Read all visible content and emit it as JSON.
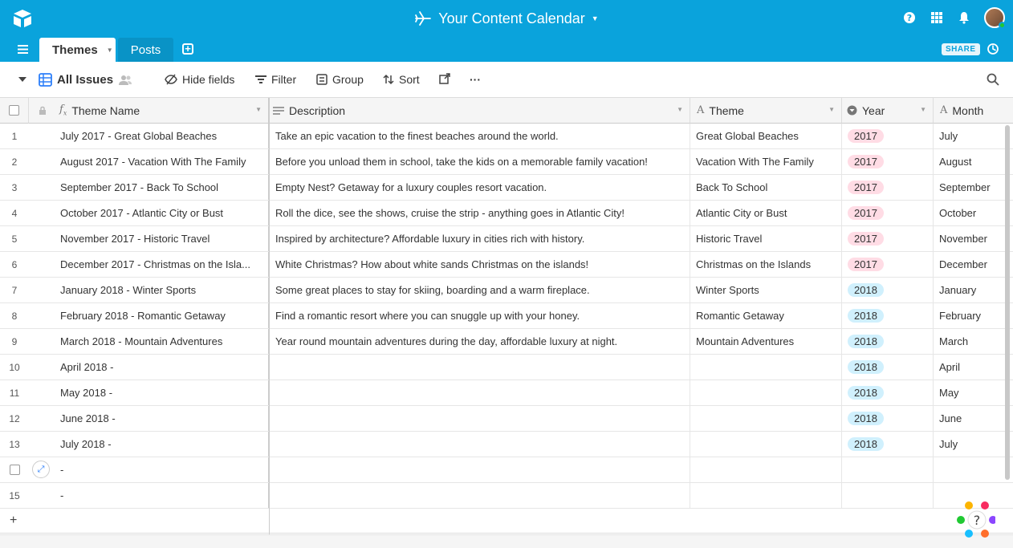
{
  "app": {
    "title": "Your Content Calendar",
    "brand_color": "#0aa3dc"
  },
  "tabs": [
    {
      "label": "Themes",
      "active": true
    },
    {
      "label": "Posts",
      "active": false
    }
  ],
  "share_label": "SHARE",
  "toolbar": {
    "view_name": "All Issues",
    "hide_fields": "Hide fields",
    "filter": "Filter",
    "group": "Group",
    "sort": "Sort",
    "more": "···"
  },
  "columns": {
    "name": "Theme Name",
    "description": "Description",
    "theme": "Theme",
    "year": "Year",
    "month": "Month"
  },
  "rows": [
    {
      "num": "1",
      "name": "July 2017 - Great Global Beaches",
      "description": "Take an epic vacation to the finest beaches around the world.",
      "theme": "Great Global Beaches",
      "year": "2017",
      "month": "July"
    },
    {
      "num": "2",
      "name": "August 2017 - Vacation With The Family",
      "description": "Before you unload them in school, take the kids on a memorable family vacation!",
      "theme": "Vacation With The Family",
      "year": "2017",
      "month": "August"
    },
    {
      "num": "3",
      "name": "September 2017 - Back To School",
      "description": "Empty Nest?  Getaway for a luxury couples resort vacation.",
      "theme": "Back To School",
      "year": "2017",
      "month": "September"
    },
    {
      "num": "4",
      "name": "October 2017 - Atlantic City or Bust",
      "description": "Roll the dice, see the shows, cruise the strip - anything goes in Atlantic City!",
      "theme": "Atlantic City or Bust",
      "year": "2017",
      "month": "October"
    },
    {
      "num": "5",
      "name": "November 2017 - Historic Travel",
      "description": "Inspired by architecture?  Affordable luxury in cities rich with history.",
      "theme": "Historic Travel",
      "year": "2017",
      "month": "November"
    },
    {
      "num": "6",
      "name": "December 2017 - Christmas on the Isla...",
      "description": "White Christmas?  How about white sands Christmas on the islands!",
      "theme": "Christmas on the Islands",
      "year": "2017",
      "month": "December"
    },
    {
      "num": "7",
      "name": "January 2018 - Winter Sports",
      "description": "Some great places to stay for skiing, boarding and a warm fireplace.",
      "theme": "Winter Sports",
      "year": "2018",
      "month": "January"
    },
    {
      "num": "8",
      "name": "February 2018 - Romantic Getaway",
      "description": "Find a romantic resort where you can snuggle up with your honey.",
      "theme": "Romantic Getaway",
      "year": "2018",
      "month": "February"
    },
    {
      "num": "9",
      "name": "March 2018 - Mountain Adventures",
      "description": "Year round mountain adventures during the day, affordable luxury at night.",
      "theme": "Mountain Adventures",
      "year": "2018",
      "month": "March"
    },
    {
      "num": "10",
      "name": "April 2018 -",
      "description": "",
      "theme": "",
      "year": "2018",
      "month": "April"
    },
    {
      "num": "11",
      "name": "May 2018 -",
      "description": "",
      "theme": "",
      "year": "2018",
      "month": "May"
    },
    {
      "num": "12",
      "name": "June 2018 -",
      "description": "",
      "theme": "",
      "year": "2018",
      "month": "June"
    },
    {
      "num": "13",
      "name": "July 2018 -",
      "description": "",
      "theme": "",
      "year": "2018",
      "month": "July"
    },
    {
      "num": "",
      "name": "-",
      "description": "",
      "theme": "",
      "year": "",
      "month": "",
      "hovered": true
    },
    {
      "num": "15",
      "name": "-",
      "description": "",
      "theme": "",
      "year": "",
      "month": ""
    }
  ],
  "add_row_label": "+",
  "colors": {
    "year_2017": "#ffdce5",
    "year_2018": "#d0f0fd"
  }
}
